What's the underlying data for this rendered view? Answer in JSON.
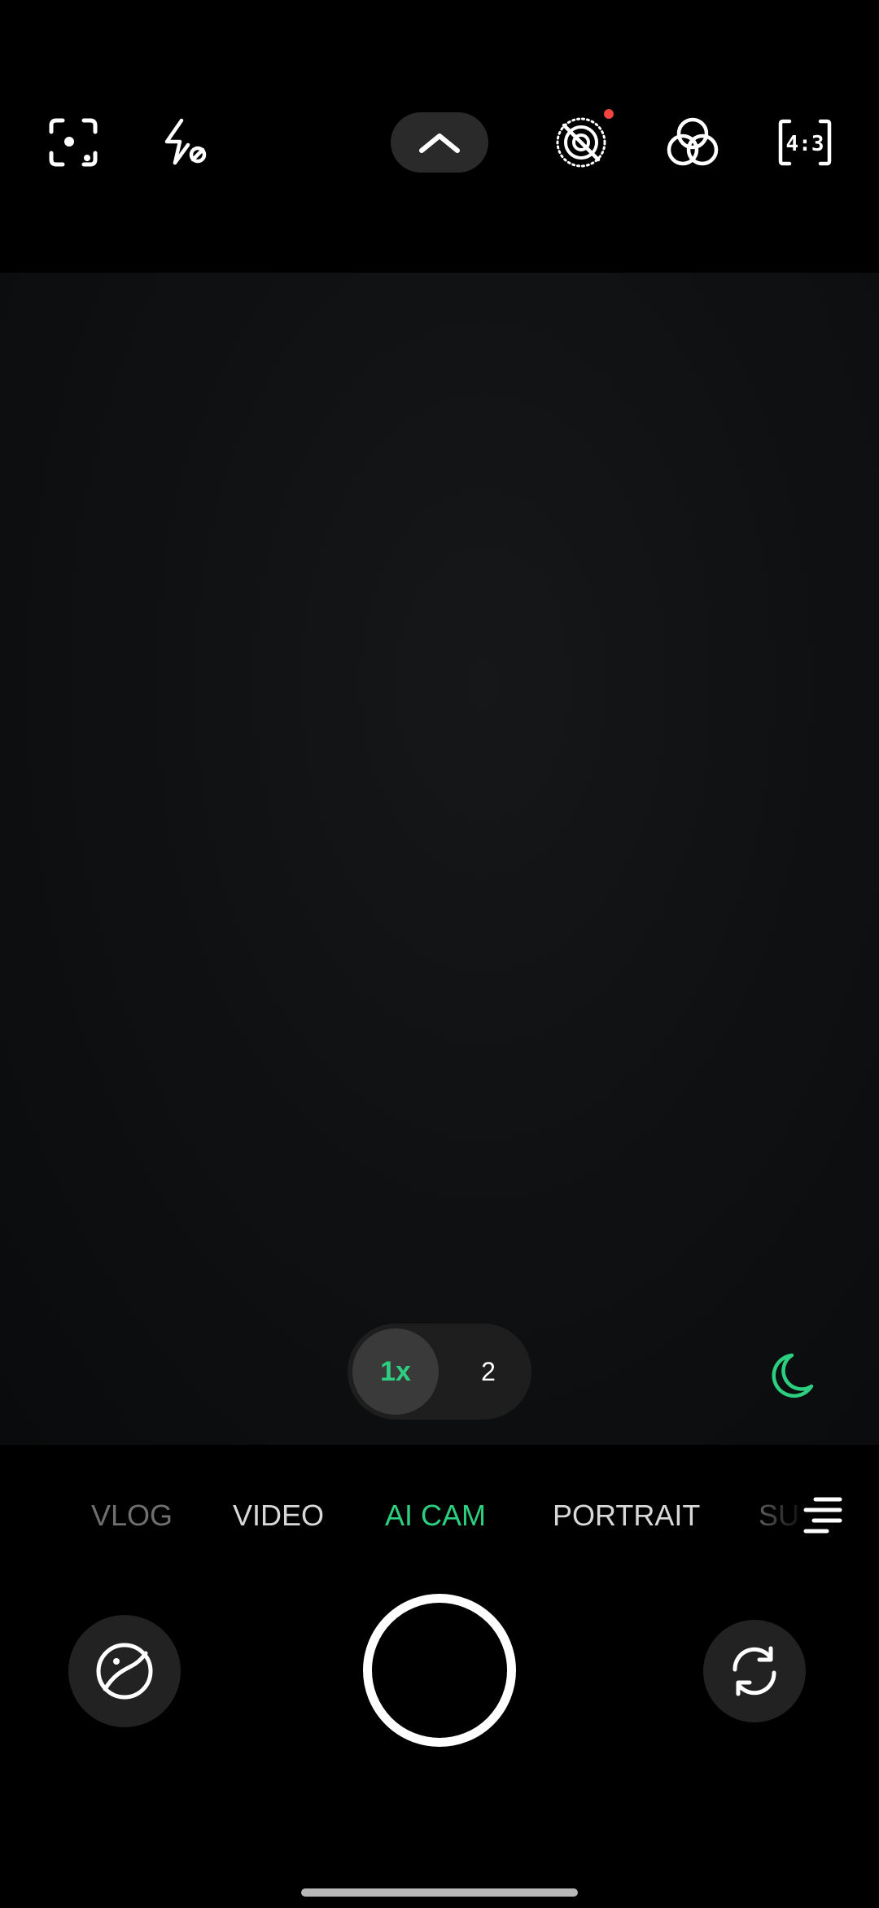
{
  "colors": {
    "accent": "#2ccf7f",
    "notification_dot": "#f0443c"
  },
  "top_toolbar": {
    "icons": [
      "scan-icon",
      "flash-off-icon",
      "chevron-up-icon",
      "live-photo-off-icon",
      "filters-icon",
      "aspect-ratio-icon"
    ],
    "aspect_ratio_label": "4:3"
  },
  "zoom": {
    "active_label": "1x",
    "other_label": "2"
  },
  "night_mode_icon": "moon-icon",
  "modes": {
    "items": [
      "VLOG",
      "VIDEO",
      "AI CAM",
      "PORTRAIT",
      "SU"
    ],
    "active": "AI CAM"
  },
  "bottom_controls": {
    "left_icon": "gallery-icon",
    "right_icon": "switch-camera-icon"
  }
}
